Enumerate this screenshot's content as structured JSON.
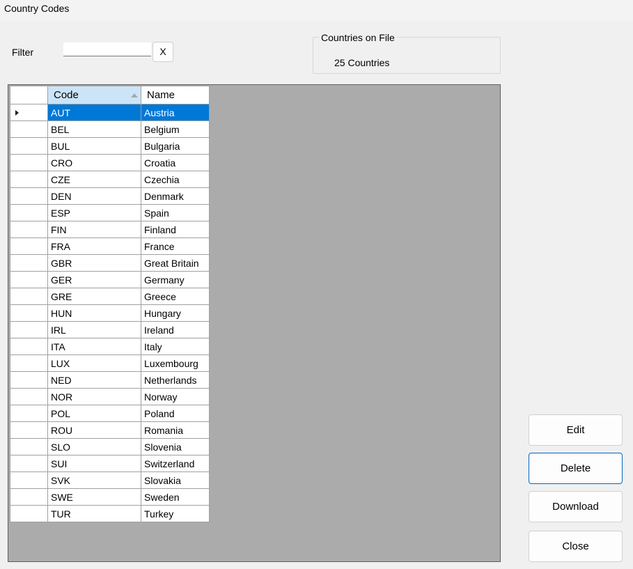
{
  "window": {
    "title": "Country Codes"
  },
  "filter": {
    "label": "Filter",
    "value": "",
    "clear_label": "X"
  },
  "summary": {
    "group_title": "Countries on File",
    "count_text": "25 Countries"
  },
  "grid": {
    "columns": [
      "Code",
      "Name"
    ],
    "sorted_column": "Code",
    "sort_direction": "ascending",
    "selected_index": 0,
    "rows": [
      {
        "code": "AUT",
        "name": "Austria"
      },
      {
        "code": "BEL",
        "name": "Belgium"
      },
      {
        "code": "BUL",
        "name": "Bulgaria"
      },
      {
        "code": "CRO",
        "name": "Croatia"
      },
      {
        "code": "CZE",
        "name": "Czechia"
      },
      {
        "code": "DEN",
        "name": "Denmark"
      },
      {
        "code": "ESP",
        "name": "Spain"
      },
      {
        "code": "FIN",
        "name": "Finland"
      },
      {
        "code": "FRA",
        "name": "France"
      },
      {
        "code": "GBR",
        "name": "Great Britain"
      },
      {
        "code": "GER",
        "name": "Germany"
      },
      {
        "code": "GRE",
        "name": "Greece"
      },
      {
        "code": "HUN",
        "name": "Hungary"
      },
      {
        "code": "IRL",
        "name": "Ireland"
      },
      {
        "code": "ITA",
        "name": "Italy"
      },
      {
        "code": "LUX",
        "name": "Luxembourg"
      },
      {
        "code": "NED",
        "name": "Netherlands"
      },
      {
        "code": "NOR",
        "name": "Norway"
      },
      {
        "code": "POL",
        "name": "Poland"
      },
      {
        "code": "ROU",
        "name": "Romania"
      },
      {
        "code": "SLO",
        "name": "Slovenia"
      },
      {
        "code": "SUI",
        "name": "Switzerland"
      },
      {
        "code": "SVK",
        "name": "Slovakia"
      },
      {
        "code": "SWE",
        "name": "Sweden"
      },
      {
        "code": "TUR",
        "name": "Turkey"
      }
    ]
  },
  "buttons": {
    "edit": "Edit",
    "delete": "Delete",
    "download": "Download",
    "close": "Close"
  },
  "colors": {
    "selection": "#0078d7",
    "header_sorted": "#cce4f7",
    "grid_background": "#ababab",
    "default_button_border": "#0067c0"
  },
  "icons": {
    "sort": "sort-ascending-icon",
    "current_row": "row-indicator-icon"
  }
}
